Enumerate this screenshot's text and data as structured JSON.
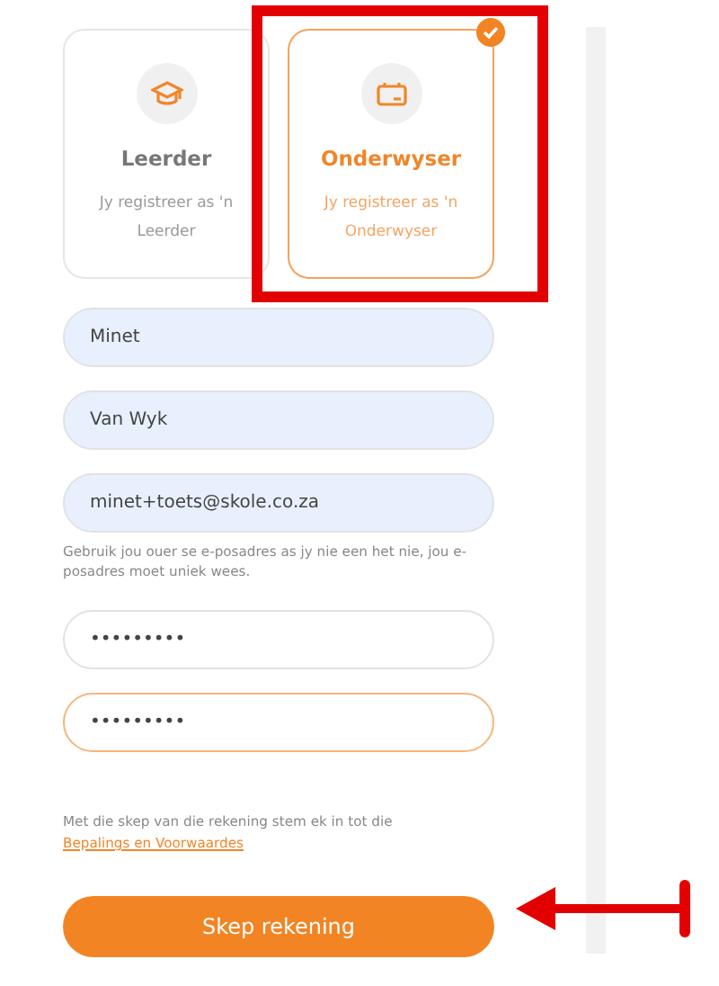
{
  "roles": [
    {
      "kind": "student",
      "title": "Leerder",
      "description": "Jy registreer as 'n Leerder",
      "selected": false
    },
    {
      "kind": "teacher",
      "title": "Onderwyser",
      "description": "Jy registreer as 'n Onderwyser",
      "selected": true
    }
  ],
  "fields": [
    {
      "value": "Minet",
      "autofilled": true,
      "focused": false
    },
    {
      "value": "Van Wyk",
      "autofilled": true,
      "focused": false
    },
    {
      "value": "minet+toets@skole.co.za",
      "autofilled": true,
      "focused": false,
      "hint": "Gebruik jou ouer se e-posadres as jy nie een het nie, jou e-posadres moet uniek wees."
    },
    {
      "value": "•••••••••",
      "autofilled": false,
      "focused": false
    },
    {
      "value": "•••••••••",
      "autofilled": false,
      "focused": true
    }
  ],
  "terms": {
    "text": "Met die skep van die rekening stem ek in tot die",
    "link": "Bepalings en Voorwaardes"
  },
  "submit": {
    "label": "Skep rekening"
  }
}
